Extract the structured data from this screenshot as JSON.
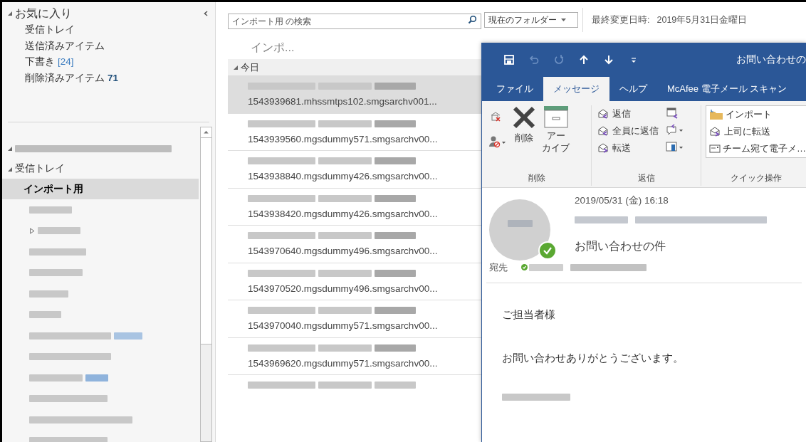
{
  "navigation": {
    "favorites": {
      "label": "お気に入り",
      "expanded": true,
      "items": [
        {
          "label": "受信トレイ"
        },
        {
          "label": "送信済みアイテム"
        },
        {
          "label": "下書き",
          "count": "[24]",
          "kind": "bracketed"
        },
        {
          "label": "削除済みアイテム",
          "count": "71",
          "kind": "bold"
        }
      ]
    },
    "folders": [
      {
        "label": "受信トレイ",
        "expanded": true,
        "children": [
          {
            "label": "インポート用",
            "selected": true
          }
        ]
      }
    ]
  },
  "search": {
    "placeholder": "インポート用 の検索",
    "scope": "現在のフォルダー"
  },
  "modified": {
    "label": "最終変更日時:",
    "value": "2019年5月31日金曜日"
  },
  "message_list": {
    "column_header": "インポ...",
    "groups": [
      {
        "label": "今日",
        "expanded": true,
        "messages": [
          {
            "text": "1543939681.mhssmtps102.smgsarchv001...",
            "selected": true
          },
          {
            "text": "1543939560.mgsdummy571.smgsarchv00...",
            "selected": false
          },
          {
            "text": "1543938840.mgsdummy426.smgsarchv00...",
            "selected": false
          },
          {
            "text": "1543938420.mgsdummy426.smgsarchv00...",
            "selected": false
          },
          {
            "text": "1543970640.mgsdummy496.smgsarchv00...",
            "selected": false
          },
          {
            "text": "1543970520.mgsdummy496.smgsarchv00...",
            "selected": false
          },
          {
            "text": "1543970040.mgsdummy571.smgsarchv00...",
            "selected": false
          },
          {
            "text": "1543969620.mgsdummy571.smgsarchv00...",
            "selected": false
          }
        ]
      }
    ]
  },
  "message_window": {
    "title": "お問い合わせの",
    "tabs": [
      {
        "label": "ファイル",
        "selected": false
      },
      {
        "label": "メッセージ",
        "selected": true
      },
      {
        "label": "ヘルプ",
        "selected": false
      },
      {
        "label": "McAfee 電子メール スキャン",
        "selected": false
      }
    ],
    "ribbon": {
      "groups": [
        {
          "label": "削除",
          "buttons": [
            {
              "label": "削除"
            },
            {
              "label": "アーカイブ"
            }
          ]
        },
        {
          "label": "返信",
          "buttons": [
            {
              "label": "返信"
            },
            {
              "label": "全員に返信"
            },
            {
              "label": "転送"
            }
          ]
        },
        {
          "label": "クイック操作",
          "buttons": [
            {
              "label": "インポート"
            },
            {
              "label": "上司に転送"
            },
            {
              "label": "チーム宛て電子メ…"
            }
          ]
        }
      ]
    },
    "date": "2019/05/31 (金) 16:18",
    "subject": "お問い合わせの件",
    "to_label": "宛先",
    "body": [
      "ご担当者様",
      "お問い合わせありがとうございます。"
    ]
  }
}
